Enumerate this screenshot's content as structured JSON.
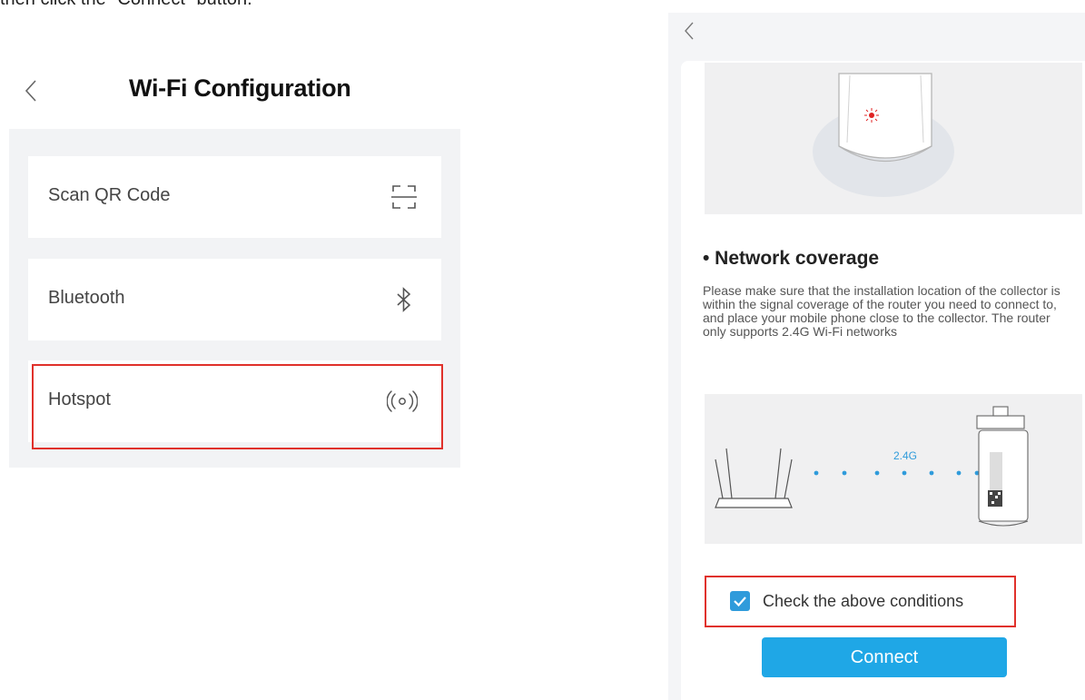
{
  "caption": "then click the \"Connect\" button.",
  "left_screen": {
    "title": "Wi-Fi Configuration",
    "options": [
      {
        "label": "Scan QR Code",
        "icon": "scan-qr-icon"
      },
      {
        "label": "Bluetooth",
        "icon": "bluetooth-icon"
      },
      {
        "label": "Hotspot",
        "icon": "hotspot-icon"
      }
    ],
    "highlighted_option": "Hotspot"
  },
  "right_screen": {
    "section_title": "• Network coverage",
    "section_body": "Please make sure that the installation location of the collector is within the signal coverage of the router you need to connect to, and place your mobile phone close to the collector. The router only supports 2.4G Wi-Fi networks",
    "illustration_label": "2.4G",
    "checkbox_label": "Check the above conditions",
    "checkbox_checked": true,
    "connect_label": "Connect"
  },
  "colors": {
    "highlight": "#e0312b",
    "accent": "#1fa7e6",
    "checkbox": "#2f9bdb",
    "panel_bg": "#f2f3f5"
  }
}
